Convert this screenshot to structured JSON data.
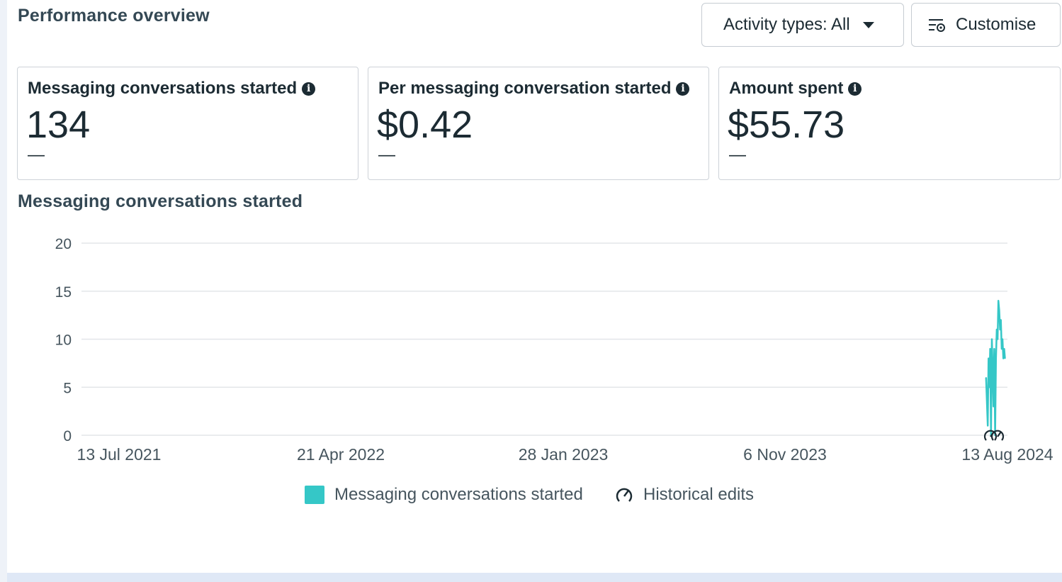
{
  "header": {
    "title": "Performance overview",
    "activity_button": "Activity types: All",
    "customise_button": "Customise"
  },
  "cards": [
    {
      "label": "Messaging conversations started",
      "value": "134",
      "delta": "—"
    },
    {
      "label": "Per messaging conversation started",
      "value": "$0.42",
      "delta": "—"
    },
    {
      "label": "Amount spent",
      "value": "$55.73",
      "delta": "—"
    }
  ],
  "chart_section_title": "Messaging conversations started",
  "legend": {
    "series_label": "Messaging conversations started",
    "edits_label": "Historical edits"
  },
  "colors": {
    "series": "#35c7c7",
    "grid": "#e3e6e9"
  },
  "chart_data": {
    "type": "line",
    "title": "Messaging conversations started",
    "ylim": [
      0,
      20
    ],
    "yticks": [
      0,
      5,
      10,
      15,
      20
    ],
    "xticks": [
      "13 Jul 2021",
      "21 Apr 2022",
      "28 Jan 2023",
      "6 Nov 2023",
      "13 Aug 2024"
    ],
    "xlim": [
      "2021-07-13",
      "2024-08-13"
    ],
    "grid": true,
    "legend_position": "bottom",
    "series": [
      {
        "name": "Messaging conversations started",
        "x": [
          "2024-07-18",
          "2024-07-20",
          "2024-07-21",
          "2024-07-22",
          "2024-07-23",
          "2024-07-24",
          "2024-07-25",
          "2024-07-26",
          "2024-07-27",
          "2024-07-28",
          "2024-07-29",
          "2024-07-30",
          "2024-07-31",
          "2024-08-01",
          "2024-08-02",
          "2024-08-03",
          "2024-08-04",
          "2024-08-05",
          "2024-08-06",
          "2024-08-07",
          "2024-08-08",
          "2024-08-09",
          "2024-08-10"
        ],
        "values": [
          6,
          1,
          8,
          5,
          9,
          0,
          10,
          7,
          3,
          9,
          0,
          8,
          11,
          10,
          14,
          13,
          11,
          12,
          9,
          10,
          8,
          9,
          8
        ]
      }
    ],
    "annotations": [
      "Historical edits"
    ]
  }
}
